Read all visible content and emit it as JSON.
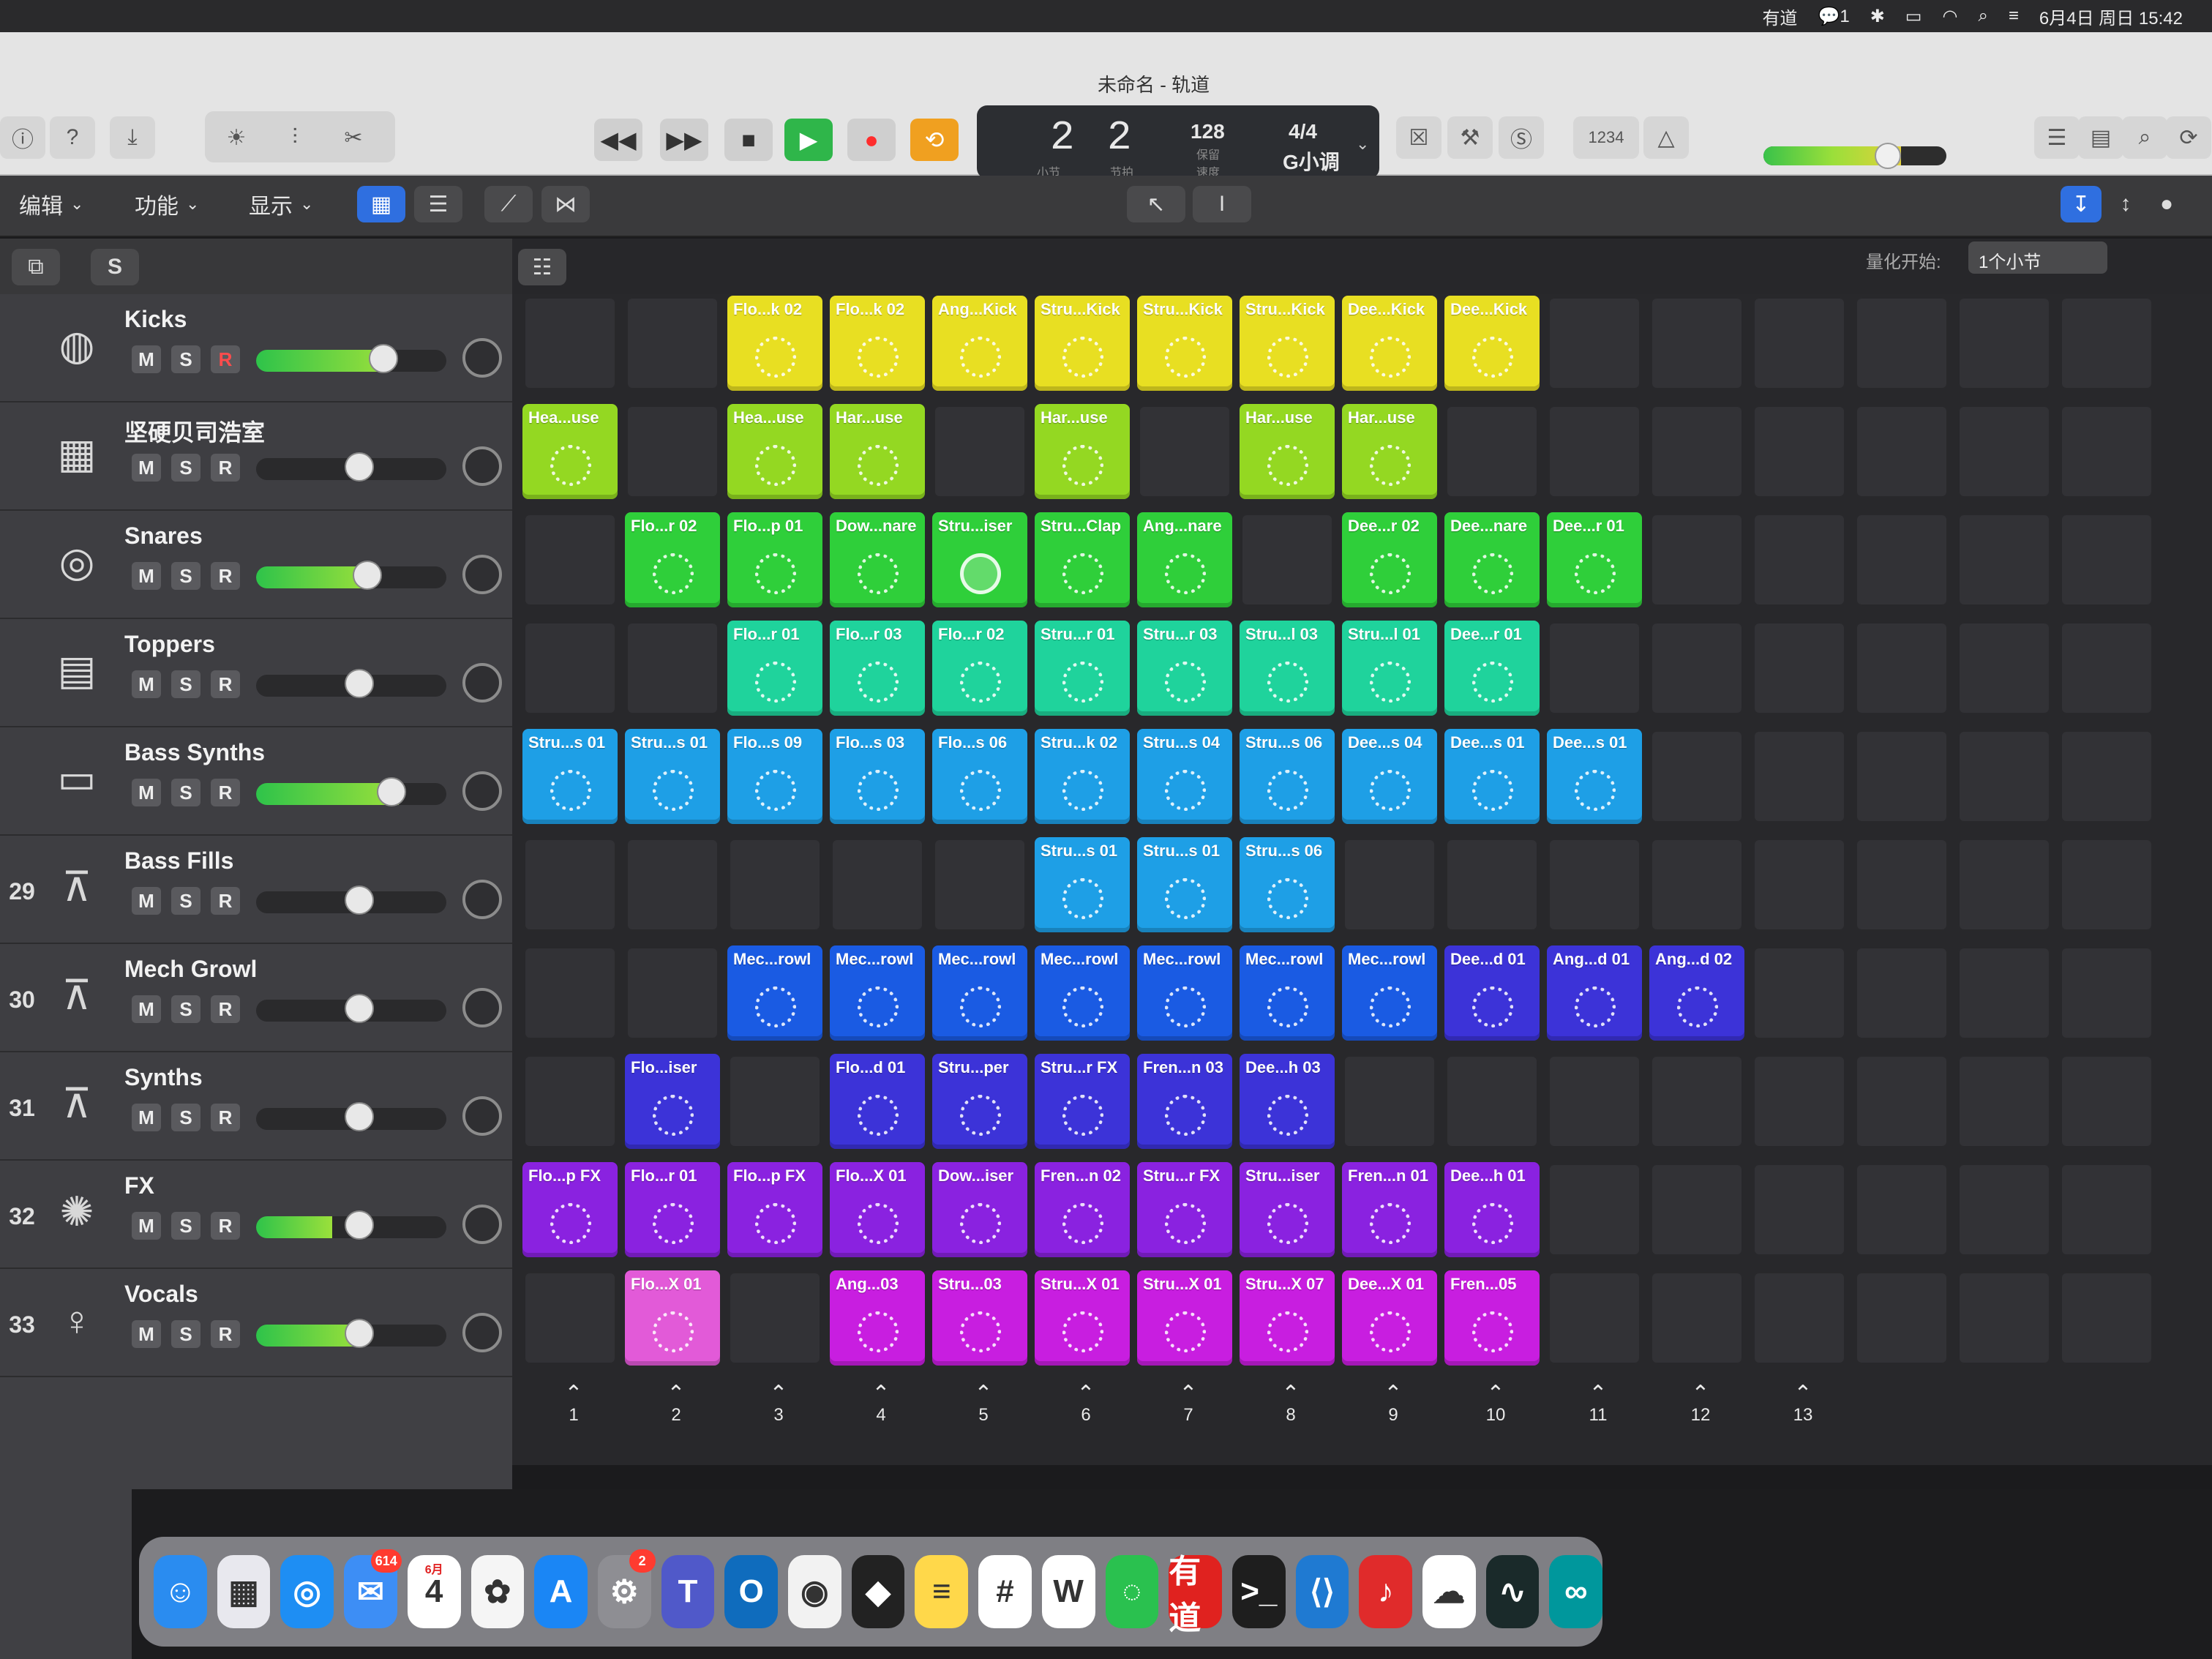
{
  "menubar": {
    "items": [
      "有道",
      "1",
      "6月4日 周日 15:42"
    ]
  },
  "window": {
    "title": "未命名 - 轨道"
  },
  "transport": {
    "bar": "2",
    "beat": "2",
    "bar_label": "小节",
    "beat_label": "节拍",
    "tempo": "128",
    "tempo_label": "保留",
    "tempo_sub": "速度",
    "time_sig": "4/4",
    "key": "G小调",
    "counter_label": "1234"
  },
  "editbar": {
    "menus": [
      "编辑",
      "功能",
      "显示"
    ]
  },
  "headbar": {
    "s_label": "S",
    "quant_label": "量化开始:",
    "quant_value": "1个小节"
  },
  "tracks": [
    {
      "name": "Kicks",
      "num": "",
      "icon": "kick-drum-icon",
      "fill": 0.7,
      "rec": true
    },
    {
      "name": "坚硬贝司浩室",
      "num": "",
      "icon": "drum-machine-icon",
      "fill": 0.0,
      "rec": false
    },
    {
      "name": "Snares",
      "num": "",
      "icon": "snare-drum-icon",
      "fill": 0.6,
      "rec": false
    },
    {
      "name": "Toppers",
      "num": "",
      "icon": "sampler-icon",
      "fill": 0.0,
      "rec": false
    },
    {
      "name": "Bass Synths",
      "num": "",
      "icon": "synth-icon",
      "fill": 0.75,
      "rec": false
    },
    {
      "name": "Bass Fills",
      "num": "29",
      "icon": "keyboard-stand-icon",
      "fill": 0.0,
      "rec": false
    },
    {
      "name": "Mech Growl",
      "num": "30",
      "icon": "keyboard-stand-icon",
      "fill": 0.0,
      "rec": false
    },
    {
      "name": "Synths",
      "num": "31",
      "icon": "keyboard-stand-icon",
      "fill": 0.0,
      "rec": false
    },
    {
      "name": "FX",
      "num": "32",
      "icon": "sparkle-icon",
      "fill": 0.4,
      "rec": false
    },
    {
      "name": "Vocals",
      "num": "33",
      "icon": "singer-icon",
      "fill": 0.55,
      "rec": false
    }
  ],
  "msr": {
    "m": "M",
    "s": "S",
    "r": "R"
  },
  "cells": [
    {
      "label": "Flo...k 02",
      "row": 0,
      "col": 2,
      "color": "yellow"
    },
    {
      "label": "Flo...k 02",
      "row": 0,
      "col": 3,
      "color": "yellow"
    },
    {
      "label": "Ang...Kick",
      "row": 0,
      "col": 4,
      "color": "yellow"
    },
    {
      "label": "Stru...Kick",
      "row": 0,
      "col": 5,
      "color": "yellow"
    },
    {
      "label": "Stru...Kick",
      "row": 0,
      "col": 6,
      "color": "yellow"
    },
    {
      "label": "Stru...Kick",
      "row": 0,
      "col": 7,
      "color": "yellow"
    },
    {
      "label": "Dee...Kick",
      "row": 0,
      "col": 8,
      "color": "yellow"
    },
    {
      "label": "Dee...Kick",
      "row": 0,
      "col": 9,
      "color": "yellow"
    },
    {
      "label": "Hea...use",
      "row": 1,
      "col": 0,
      "color": "lime"
    },
    {
      "label": "Hea...use",
      "row": 1,
      "col": 2,
      "color": "lime"
    },
    {
      "label": "Har...use",
      "row": 1,
      "col": 3,
      "color": "lime"
    },
    {
      "label": "Har...use",
      "row": 1,
      "col": 5,
      "color": "lime"
    },
    {
      "label": "Har...use",
      "row": 1,
      "col": 7,
      "color": "lime"
    },
    {
      "label": "Har...use",
      "row": 1,
      "col": 8,
      "color": "lime"
    },
    {
      "label": "Flo...r 02",
      "row": 2,
      "col": 1,
      "color": "green"
    },
    {
      "label": "Flo...p 01",
      "row": 2,
      "col": 2,
      "color": "green"
    },
    {
      "label": "Dow...nare",
      "row": 2,
      "col": 3,
      "color": "green"
    },
    {
      "label": "Stru...iser",
      "row": 2,
      "col": 4,
      "color": "green",
      "playing": true
    },
    {
      "label": "Stru...Clap",
      "row": 2,
      "col": 5,
      "color": "green"
    },
    {
      "label": "Ang...nare",
      "row": 2,
      "col": 6,
      "color": "green"
    },
    {
      "label": "Dee...r 02",
      "row": 2,
      "col": 8,
      "color": "green"
    },
    {
      "label": "Dee...nare",
      "row": 2,
      "col": 9,
      "color": "green"
    },
    {
      "label": "Dee...r 01",
      "row": 2,
      "col": 10,
      "color": "green"
    },
    {
      "label": "Flo...r 01",
      "row": 3,
      "col": 2,
      "color": "teal"
    },
    {
      "label": "Flo...r 03",
      "row": 3,
      "col": 3,
      "color": "teal"
    },
    {
      "label": "Flo...r 02",
      "row": 3,
      "col": 4,
      "color": "teal"
    },
    {
      "label": "Stru...r 01",
      "row": 3,
      "col": 5,
      "color": "teal"
    },
    {
      "label": "Stru...r 03",
      "row": 3,
      "col": 6,
      "color": "teal"
    },
    {
      "label": "Stru...l 03",
      "row": 3,
      "col": 7,
      "color": "teal"
    },
    {
      "label": "Stru...l 01",
      "row": 3,
      "col": 8,
      "color": "teal"
    },
    {
      "label": "Dee...r 01",
      "row": 3,
      "col": 9,
      "color": "teal"
    },
    {
      "label": "Stru...s 01",
      "row": 4,
      "col": 0,
      "color": "sky"
    },
    {
      "label": "Stru...s 01",
      "row": 4,
      "col": 1,
      "color": "sky"
    },
    {
      "label": "Flo...s 09",
      "row": 4,
      "col": 2,
      "color": "sky"
    },
    {
      "label": "Flo...s 03",
      "row": 4,
      "col": 3,
      "color": "sky"
    },
    {
      "label": "Flo...s 06",
      "row": 4,
      "col": 4,
      "color": "sky"
    },
    {
      "label": "Stru...k 02",
      "row": 4,
      "col": 5,
      "color": "sky"
    },
    {
      "label": "Stru...s 04",
      "row": 4,
      "col": 6,
      "color": "sky"
    },
    {
      "label": "Stru...s 06",
      "row": 4,
      "col": 7,
      "color": "sky"
    },
    {
      "label": "Dee...s 04",
      "row": 4,
      "col": 8,
      "color": "sky"
    },
    {
      "label": "Dee...s 01",
      "row": 4,
      "col": 9,
      "color": "sky"
    },
    {
      "label": "Dee...s 01",
      "row": 4,
      "col": 10,
      "color": "sky"
    },
    {
      "label": "Stru...s 01",
      "row": 5,
      "col": 5,
      "color": "sky"
    },
    {
      "label": "Stru...s 01",
      "row": 5,
      "col": 6,
      "color": "sky"
    },
    {
      "label": "Stru...s 06",
      "row": 5,
      "col": 7,
      "color": "sky"
    },
    {
      "label": "Mec...rowl",
      "row": 6,
      "col": 2,
      "color": "blue"
    },
    {
      "label": "Mec...rowl",
      "row": 6,
      "col": 3,
      "color": "blue"
    },
    {
      "label": "Mec...rowl",
      "row": 6,
      "col": 4,
      "color": "blue"
    },
    {
      "label": "Mec...rowl",
      "row": 6,
      "col": 5,
      "color": "blue"
    },
    {
      "label": "Mec...rowl",
      "row": 6,
      "col": 6,
      "color": "blue"
    },
    {
      "label": "Mec...rowl",
      "row": 6,
      "col": 7,
      "color": "blue"
    },
    {
      "label": "Mec...rowl",
      "row": 6,
      "col": 8,
      "color": "blue"
    },
    {
      "label": "Dee...d 01",
      "row": 6,
      "col": 9,
      "color": "indigo"
    },
    {
      "label": "Ang...d 01",
      "row": 6,
      "col": 10,
      "color": "indigo"
    },
    {
      "label": "Ang...d 02",
      "row": 6,
      "col": 11,
      "color": "indigo"
    },
    {
      "label": "Flo...iser",
      "row": 7,
      "col": 1,
      "color": "indigo"
    },
    {
      "label": "Flo...d 01",
      "row": 7,
      "col": 3,
      "color": "indigo"
    },
    {
      "label": "Stru...per",
      "row": 7,
      "col": 4,
      "color": "indigo"
    },
    {
      "label": "Stru...r FX",
      "row": 7,
      "col": 5,
      "color": "indigo"
    },
    {
      "label": "Fren...n 03",
      "row": 7,
      "col": 6,
      "color": "indigo"
    },
    {
      "label": "Dee...h 03",
      "row": 7,
      "col": 7,
      "color": "indigo"
    },
    {
      "label": "Flo...p FX",
      "row": 8,
      "col": 0,
      "color": "purple"
    },
    {
      "label": "Flo...r 01",
      "row": 8,
      "col": 1,
      "color": "purple"
    },
    {
      "label": "Flo...p FX",
      "row": 8,
      "col": 2,
      "color": "purple"
    },
    {
      "label": "Flo...X 01",
      "row": 8,
      "col": 3,
      "color": "purple"
    },
    {
      "label": "Dow...iser",
      "row": 8,
      "col": 4,
      "color": "purple"
    },
    {
      "label": "Fren...n 02",
      "row": 8,
      "col": 5,
      "color": "purple"
    },
    {
      "label": "Stru...r FX",
      "row": 8,
      "col": 6,
      "color": "purple"
    },
    {
      "label": "Stru...iser",
      "row": 8,
      "col": 7,
      "color": "purple"
    },
    {
      "label": "Fren...n 01",
      "row": 8,
      "col": 8,
      "color": "purple"
    },
    {
      "label": "Dee...h 01",
      "row": 8,
      "col": 9,
      "color": "purple"
    },
    {
      "label": "Flo...X 01",
      "row": 9,
      "col": 1,
      "color": "pink"
    },
    {
      "label": "Ang...03",
      "row": 9,
      "col": 3,
      "color": "magenta"
    },
    {
      "label": "Stru...03",
      "row": 9,
      "col": 4,
      "color": "magenta"
    },
    {
      "label": "Stru...X 01",
      "row": 9,
      "col": 5,
      "color": "magenta"
    },
    {
      "label": "Stru...X 01",
      "row": 9,
      "col": 6,
      "color": "magenta"
    },
    {
      "label": "Stru...X 07",
      "row": 9,
      "col": 7,
      "color": "magenta"
    },
    {
      "label": "Dee...X 01",
      "row": 9,
      "col": 8,
      "color": "magenta"
    },
    {
      "label": "Fren...05",
      "row": 9,
      "col": 9,
      "color": "magenta"
    }
  ],
  "scenes": [
    "1",
    "2",
    "3",
    "4",
    "5",
    "6",
    "7",
    "8",
    "9",
    "10",
    "11",
    "12",
    "13"
  ],
  "dock": [
    {
      "name": "finder",
      "color": "#2a8cf0",
      "glyph": "☺"
    },
    {
      "name": "launchpad",
      "color": "#e8e8ee",
      "glyph": "▦"
    },
    {
      "name": "safari",
      "color": "#1e8ef3",
      "glyph": "◎"
    },
    {
      "name": "mail",
      "color": "#3d8ef5",
      "glyph": "✉",
      "badge": "614"
    },
    {
      "name": "calendar",
      "color": "#ffffff",
      "glyph": "4",
      "month": "6月"
    },
    {
      "name": "photos",
      "color": "#f5f5f5",
      "glyph": "✿"
    },
    {
      "name": "app-store",
      "color": "#1a86f5",
      "glyph": "A"
    },
    {
      "name": "system-settings",
      "color": "#8e8e93",
      "glyph": "⚙",
      "badge": "2"
    },
    {
      "name": "teams",
      "color": "#5059c9",
      "glyph": "T"
    },
    {
      "name": "outlook",
      "color": "#0f6cbd",
      "glyph": "O"
    },
    {
      "name": "chrome",
      "color": "#f2f2f2",
      "glyph": "◉"
    },
    {
      "name": "unity",
      "color": "#222222",
      "glyph": "◆"
    },
    {
      "name": "notes",
      "color": "#ffd84a",
      "glyph": "≡"
    },
    {
      "name": "slack",
      "color": "#ffffff",
      "glyph": "#"
    },
    {
      "name": "wps",
      "color": "#ffffff",
      "glyph": "W"
    },
    {
      "name": "wechat",
      "color": "#2ac14f",
      "glyph": "◌"
    },
    {
      "name": "youdao",
      "color": "#e0221f",
      "glyph": "有道"
    },
    {
      "name": "terminal",
      "color": "#1e1e1e",
      "glyph": ">_"
    },
    {
      "name": "vscode",
      "color": "#1f7ad2",
      "glyph": "⟨⟩"
    },
    {
      "name": "netease-music",
      "color": "#e02b2b",
      "glyph": "♪"
    },
    {
      "name": "baidu-netdisk",
      "color": "#ffffff",
      "glyph": "☁"
    },
    {
      "name": "activity-monitor",
      "color": "#1a2a2a",
      "glyph": "∿"
    },
    {
      "name": "arduino",
      "color": "#00979c",
      "glyph": "∞"
    }
  ]
}
